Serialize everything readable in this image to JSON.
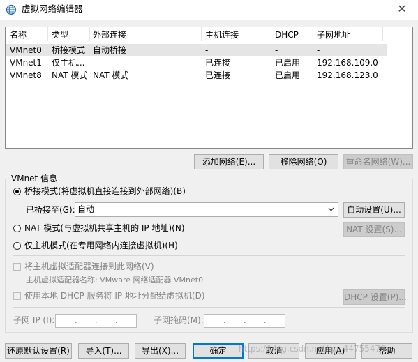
{
  "window": {
    "title": "虚拟网络编辑器",
    "close_glyph": "✕"
  },
  "table": {
    "headers": [
      "名称",
      "类型",
      "外部连接",
      "主机连接",
      "DHCP",
      "子网地址"
    ],
    "rows": [
      [
        "VMnet0",
        "桥接模式",
        "自动桥接",
        "-",
        "-",
        "-"
      ],
      [
        "VMnet1",
        "仅主机...",
        "-",
        "已连接",
        "已启用",
        "192.168.109.0"
      ],
      [
        "VMnet8",
        "NAT 模式",
        "NAT 模式",
        "已连接",
        "已启用",
        "192.168.123.0"
      ]
    ],
    "selected_row": 0
  },
  "table_buttons": {
    "add": "添加网络(E)...",
    "remove": "移除网络(O)",
    "rename": "重命名网络(W)..."
  },
  "vmnet_info": {
    "legend": "VMnet 信息",
    "bridge_radio": "桥接模式(将虚拟机直接连接到外部网络)(B)",
    "bridged_to_label": "已桥接至(G):",
    "bridged_to_value": "自动",
    "auto_settings": "自动设置(U)...",
    "nat_radio": "NAT 模式(与虚拟机共享主机的 IP 地址)(N)",
    "nat_settings": "NAT 设置(S)...",
    "host_only_radio": "仅主机模式(在专用网络内连接虚拟机)(H)",
    "selected_mode": "bridge",
    "connect_adapter": "将主机虚拟适配器连接到此网络(V)",
    "adapter_name": "主机虚拟适配器名称: VMware 网络适配器 VMnet0",
    "use_dhcp": "使用本地 DHCP 服务将 IP 地址分配给虚拟机(D)",
    "dhcp_settings": "DHCP 设置(P)...",
    "subnet_ip_label": "子网 IP (I):",
    "subnet_mask_label": "子网掩码(M):",
    "ip_dot": "."
  },
  "bottom_buttons": {
    "restore": "还原默认设置(R)",
    "import": "导入(T)...",
    "export": "导出(X)...",
    "ok": "确定",
    "cancel": "取消",
    "apply": "应用(A)",
    "help": "帮助"
  },
  "watermark": "https://blog.csdn.net/qq_44755470"
}
